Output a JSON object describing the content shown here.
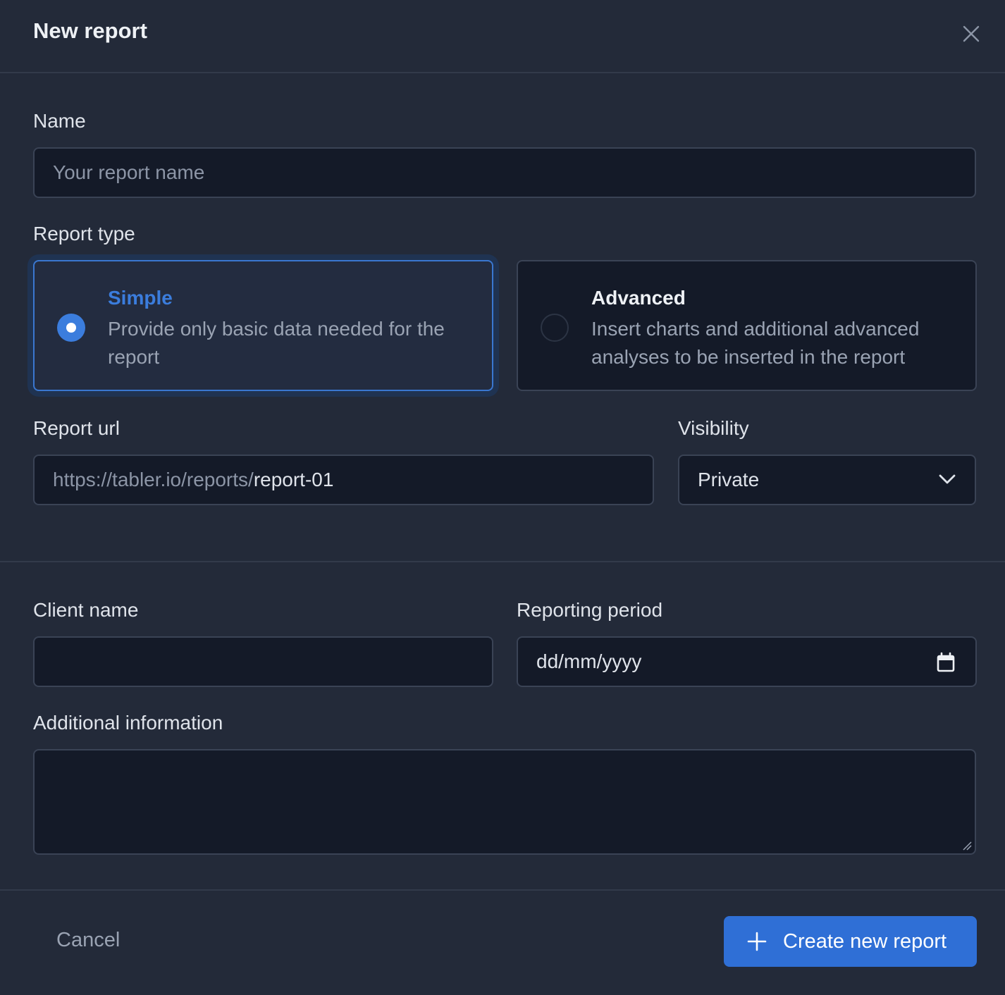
{
  "header": {
    "title": "New report"
  },
  "form": {
    "name": {
      "label": "Name",
      "placeholder": "Your report name"
    },
    "report_type": {
      "label": "Report type",
      "options": [
        {
          "title": "Simple",
          "description": "Provide only basic data needed for the report",
          "selected": true
        },
        {
          "title": "Advanced",
          "description": "Insert charts and additional advanced analyses to be inserted in the report",
          "selected": false
        }
      ]
    },
    "report_url": {
      "label": "Report url",
      "prefix": "https://tabler.io/reports/",
      "value": "report-01"
    },
    "visibility": {
      "label": "Visibility",
      "value": "Private"
    },
    "client_name": {
      "label": "Client name",
      "value": ""
    },
    "reporting_period": {
      "label": "Reporting period",
      "placeholder": "dd/mm/yyyy"
    },
    "additional_info": {
      "label": "Additional information",
      "value": ""
    }
  },
  "footer": {
    "cancel_label": "Cancel",
    "create_label": "Create new report"
  },
  "colors": {
    "accent": "#2f6fd6",
    "background": "#232a39",
    "input_bg": "#141a28"
  },
  "icons": {
    "close": "close-icon",
    "chevron": "chevron-down-icon",
    "calendar": "calendar-icon",
    "plus": "plus-icon"
  }
}
